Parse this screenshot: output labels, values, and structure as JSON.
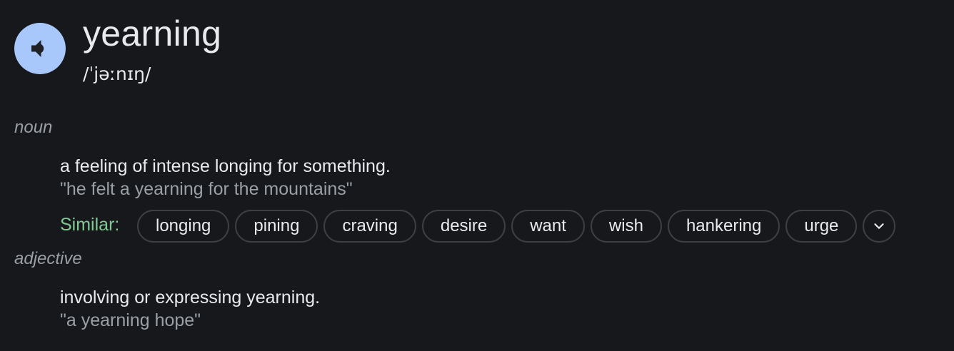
{
  "entry": {
    "word": "yearning",
    "phonetic": "/ˈjəːnɪŋ/",
    "speaker_icon": "speaker-volume-icon",
    "speaker_bg": "#a8c7fa"
  },
  "senses": [
    {
      "part_of_speech": "noun",
      "definition": "a feeling of intense longing for something.",
      "example": "\"he felt a yearning for the mountains\"",
      "similar_label": "Similar:",
      "similar": [
        "longing",
        "pining",
        "craving",
        "desire",
        "want",
        "wish",
        "hankering",
        "urge"
      ],
      "expand_icon": "chevron-down-icon"
    },
    {
      "part_of_speech": "adjective",
      "definition": "involving or expressing yearning.",
      "example": "\"a yearning hope\""
    }
  ],
  "colors": {
    "background": "#17181c",
    "text": "#e8eaed",
    "muted": "#9aa0a6",
    "similar_label": "#81c995",
    "chip_border": "#3c4043"
  }
}
